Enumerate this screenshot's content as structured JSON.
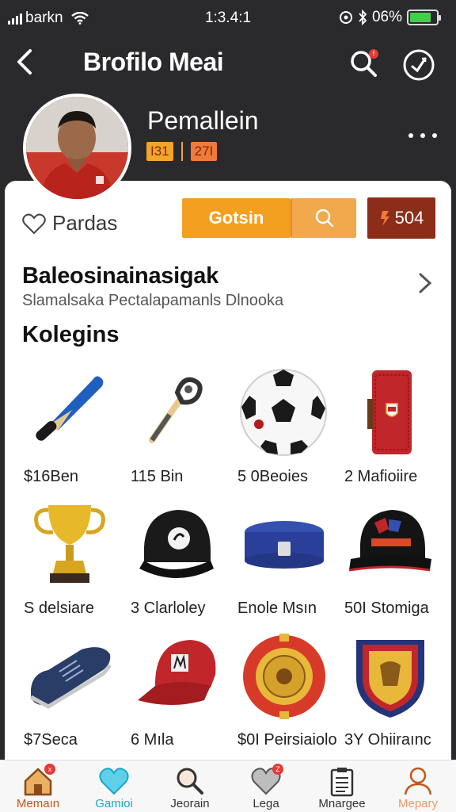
{
  "status_bar": {
    "carrier": "barkn",
    "time": "1:3.4:1",
    "battery": "06%",
    "battery_level": 0.8,
    "battery_color": "#3fcf4e"
  },
  "header": {
    "title": "Brofilo Meai",
    "notification_badge": "!"
  },
  "profile": {
    "name": "Pemallein",
    "badge_one": "I31",
    "badge_two": "27I"
  },
  "actions": {
    "favorite_label": "Pardas",
    "primary_label": "Gotsin",
    "count_value": "504"
  },
  "section": {
    "title": "Baleosinainasigak",
    "subtitle": "Slamalsaka Pectalapamanls Dlnooka"
  },
  "category": {
    "title": "Kolegins"
  },
  "items": [
    {
      "label": "$16Ben",
      "icon": "baseball-bat-icon"
    },
    {
      "label": "115 Bin",
      "icon": "racket-icon"
    },
    {
      "label": "5 0Beoies",
      "icon": "soccer-ball-icon"
    },
    {
      "label": "2 Mafioiire",
      "icon": "wallet-icon"
    },
    {
      "label": "S delsiare",
      "icon": "trophy-icon"
    },
    {
      "label": "3 Clarloley",
      "icon": "black-cap-icon"
    },
    {
      "label": "Enole Msın",
      "icon": "puck-icon"
    },
    {
      "label": "50I Stomiga",
      "icon": "team-cap-icon"
    },
    {
      "label": "$7Seca",
      "icon": "sneaker-icon"
    },
    {
      "label": "6 Mıla",
      "icon": "red-cap-icon"
    },
    {
      "label": "$0I Peirsiaiolo",
      "icon": "medal-icon"
    },
    {
      "label": "3Y Ohiiraınc",
      "icon": "crest-icon"
    }
  ],
  "bottom_nav": [
    {
      "label": "Memaın",
      "icon": "home-icon",
      "badge": "x"
    },
    {
      "label": "Gamioi",
      "icon": "heart-icon"
    },
    {
      "label": "Jeorain",
      "icon": "search-icon"
    },
    {
      "label": "Lega",
      "icon": "heart-outline-icon",
      "badge": "Z"
    },
    {
      "label": "Mnargee",
      "icon": "clipboard-icon"
    },
    {
      "label": "Mepary",
      "icon": "person-icon"
    }
  ],
  "colors": {
    "header_bg": "#2a2a2c",
    "accent_orange": "#f3a020",
    "count_bg": "#8b2d18",
    "active_nav": "#1aa6c9"
  }
}
